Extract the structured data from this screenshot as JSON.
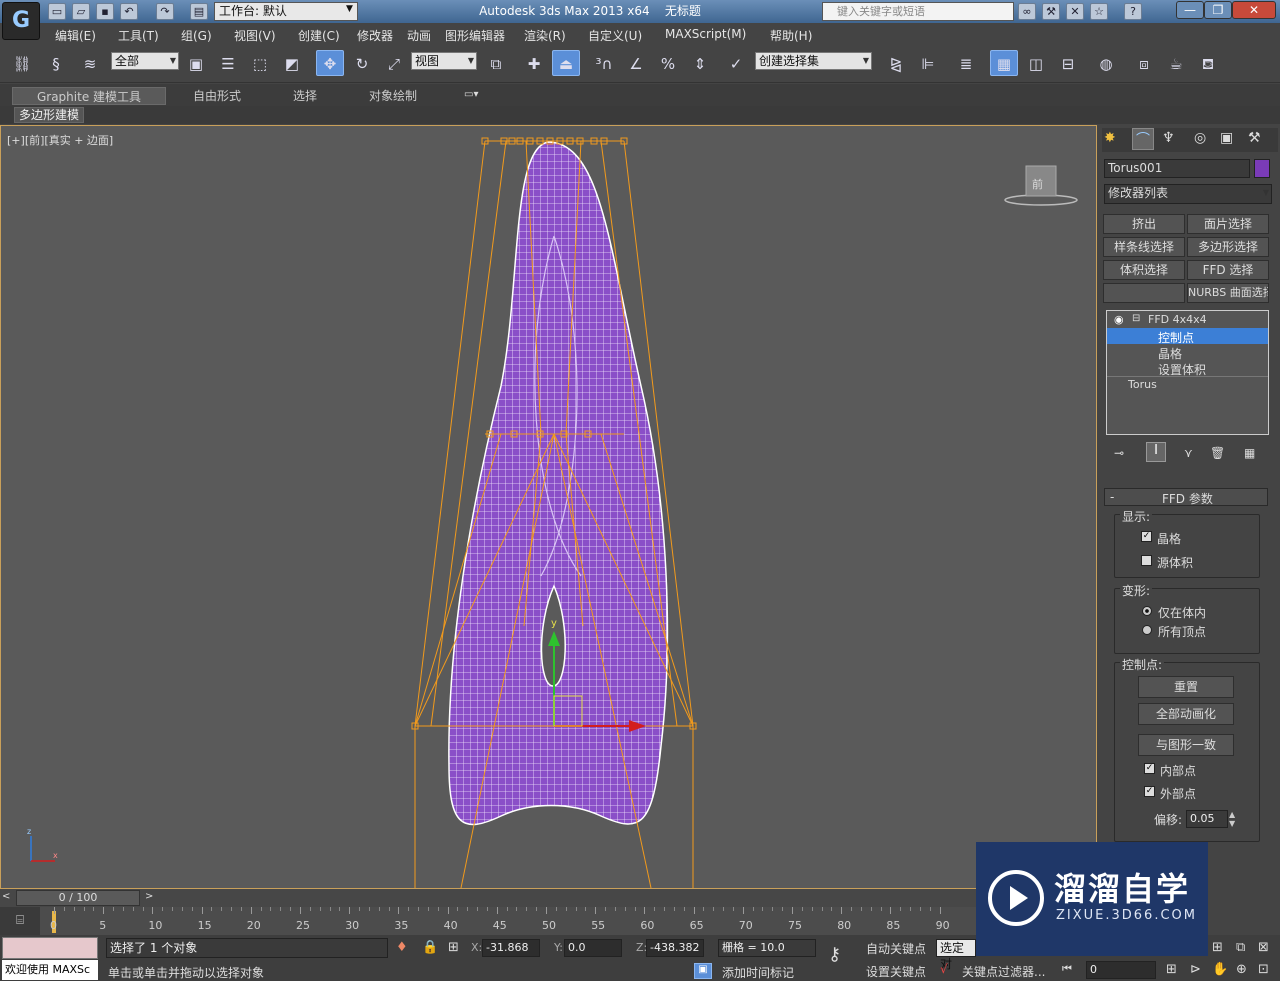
{
  "titlebar": {
    "workspace": "工作台: 默认",
    "app_title": "Autodesk 3ds Max  2013 x64",
    "doc_title": "无标题",
    "search_placeholder": "键入关键字或短语"
  },
  "menu": [
    "编辑(E)",
    "工具(T)",
    "组(G)",
    "视图(V)",
    "创建(C)",
    "修改器",
    "动画",
    "图形编辑器",
    "渲染(R)",
    "自定义(U)",
    "MAXScript(M)",
    "帮助(H)"
  ],
  "toolbar": {
    "filter_select": "全部",
    "ref_coord": "视图",
    "selection_set": "创建选择集"
  },
  "ribbon": {
    "tabs": [
      "Graphite 建模工具",
      "自由形式",
      "选择",
      "对象绘制"
    ],
    "sub_tab": "多边形建模"
  },
  "viewport": {
    "label_plus": "[+]",
    "label_view": "[前]",
    "label_shade": "[真实 + 边面]",
    "viewcube_face": "前"
  },
  "panel": {
    "object_name": "Torus001",
    "object_color": "#7a3bb8",
    "modifier_list": "修改器列表",
    "mod_buttons": [
      "挤出",
      "面片选择",
      "样条线选择",
      "多边形选择",
      "体积选择",
      "FFD 选择",
      "",
      "NURBS 曲面选择"
    ],
    "stack": {
      "ffd": "FFD 4x4x4",
      "control_points": "控制点",
      "lattice": "晶格",
      "set_volume": "设置体积",
      "torus": "Torus"
    },
    "rollout_title": "FFD 参数",
    "display_group": "显示:",
    "lattice_cb": "晶格",
    "source_vol_cb": "源体积",
    "deform_group": "变形:",
    "only_in_volume": "仅在体内",
    "all_vertices": "所有顶点",
    "cp_group": "控制点:",
    "reset_btn": "重置",
    "animate_all_btn": "全部动画化",
    "conform_btn": "与图形一致",
    "inside_cb": "内部点",
    "outside_cb": "外部点",
    "offset_label": "偏移:",
    "offset_value": "0.05"
  },
  "timeline": {
    "frame_display": "0 / 100",
    "ticks": [
      "0",
      "5",
      "10",
      "15",
      "20",
      "25",
      "30",
      "35",
      "40",
      "45",
      "50",
      "55",
      "60",
      "65",
      "70",
      "75",
      "80",
      "85",
      "90"
    ]
  },
  "status": {
    "welcome": "欢迎使用 MAXSc",
    "selected": "选择了 1 个对象",
    "prompt": "单击或单击并拖动以选择对象",
    "x_label": "X:",
    "x_value": "-31.868",
    "y_label": "Y:",
    "y_value": "0.0",
    "z_label": "Z:",
    "z_value": "-438.382",
    "grid": "栅格 = 10.0",
    "auto_key": "自动关键点",
    "set_key": "设置关键点",
    "selected_obj": "选定对",
    "key_filter": "关键点过滤器...",
    "add_time_tag": "添加时间标记",
    "frame": "0"
  },
  "watermark": {
    "brand": "溜溜自学",
    "url": "ZIXUE.3D66.COM"
  }
}
